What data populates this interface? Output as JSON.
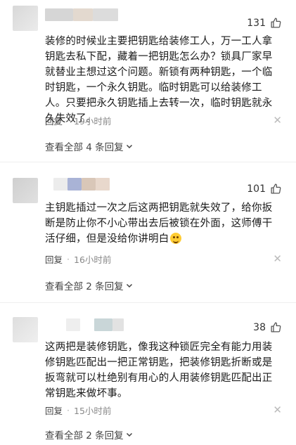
{
  "comments": [
    {
      "likes": "131",
      "text": "装修的时候业主要把钥匙给装修工人，万一工人拿钥匙去私下配，藏着一把钥匙怎么办？锁具厂家早就替业主想过这个问题。新锁有两种钥匙，一个临时钥匙，一个永久钥匙。临时钥匙可以给装修工人。只要把永久钥匙插上去转一次，临时钥匙就永久失效了。",
      "reply_label": "回复",
      "time": "19小时前",
      "view_replies": "查看全部 4 条回复"
    },
    {
      "likes": "101",
      "text": "主钥匙插过一次之后这两把钥匙就失效了，给你扳断是防止你不小心带出去后被锁在外面，这师傅干活仔细，但是没给你讲明白",
      "reply_label": "回复",
      "time": "16小时前",
      "view_replies": "查看全部 2 条回复"
    },
    {
      "likes": "38",
      "text": "这两把是装修钥匙，像我这种锁匠完全有能力用装修钥匙匹配出一把正常钥匙，把装修钥匙折断或是扳弯就可以杜绝别有用心的人用装修钥匙匹配出正常钥匙来做坏事。",
      "reply_label": "回复",
      "time": "15小时前",
      "view_replies": "查看全部 2 条回复"
    }
  ],
  "colors": {
    "text": "#1a1a1a",
    "meta": "#888888",
    "background": "#ffffff"
  },
  "icons": {
    "like": "thumbs-up-icon",
    "close": "close-icon",
    "expand": "chevron-down-icon",
    "emoji": "grinning-emoji-icon"
  }
}
